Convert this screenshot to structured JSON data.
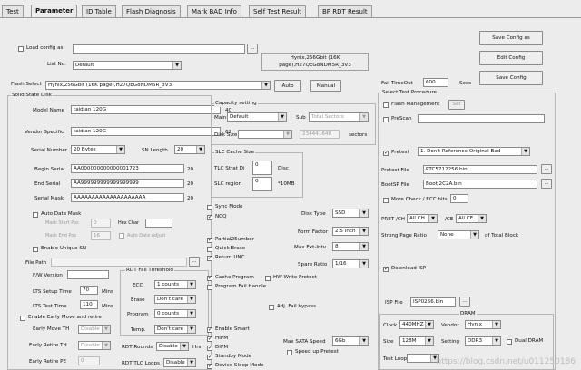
{
  "tabs": [
    "Test",
    "Parameter",
    "ID Table",
    "Flash Diagnosis",
    "Mark BAD Info",
    "Self Test Result",
    "BP RDT Result"
  ],
  "top": {
    "load_config_as": "Load config as",
    "list_no_label": "List No.",
    "list_no_value": "Default",
    "flash_select_label": "Flash Select",
    "flash_select_value": "Hynix,256Gbit (16K page),H27QEG8NDM5R_3V3",
    "info_line1": "Hynix,256Gbit (16K",
    "info_line2": "page),H27QEG8NDM5R_3V3",
    "auto_btn": "Auto",
    "manual_btn": "Manual",
    "save_config_as_btn": "Save Config as",
    "edit_config_btn": "Edit Config",
    "save_config_btn": "Save Config",
    "fail_timeout_label": "Fail TimeOut",
    "fail_timeout_value": "600",
    "fail_timeout_unit": "Secs"
  },
  "ssd": {
    "title": "Solid State Disk",
    "model_name_label": "Model Name",
    "model_name_value": "taidian 120G",
    "model_name_count": "40",
    "vendor_specific_label": "Vendor Specific",
    "vendor_specific_value": "taidian 120G",
    "vendor_specific_count": "62",
    "serial_number_label": "Serial Number",
    "serial_number_value": "20 Bytes",
    "sn_length_label": "SN Length",
    "sn_length_value": "20",
    "begin_serial_label": "Begin Serial",
    "begin_serial_value": "AA000000000000001723",
    "begin_serial_count": "20",
    "end_serial_label": "End Serial",
    "end_serial_value": "AA999999999999999999",
    "end_serial_count": "20",
    "serial_mask_label": "Serial Mask",
    "serial_mask_value": "AAAAAAAAAAAAAAAAAAAA",
    "serial_mask_count": "20",
    "auto_date_mask": "Auto Date Mask",
    "mask_start_pos_label": "Mask Start Pos",
    "mask_start_pos_value": "0",
    "hex_char_label": "Hex Char",
    "mask_end_pos_label": "Mask End Pos",
    "mask_end_pos_value": "16",
    "auto_date_adjust": "Auto Date Adjust",
    "enable_unique_sn": "Enable Unique SN",
    "file_path_label": "File Path",
    "fw_version_label": "F/W Version",
    "lts_setup_label": "LTS Setup Time",
    "lts_setup_value": "70",
    "lts_setup_unit": "Mins",
    "lts_test_label": "LTS Test Time",
    "lts_test_value": "110",
    "lts_test_unit": "Mins",
    "enable_early_move": "Enable Early Move and retire",
    "early_move_th_label": "Early Move TH",
    "early_move_th_value": "Disable",
    "early_retire_th_label": "Early Retire TH",
    "early_retire_th_value": "Disable",
    "early_retire_pe_label": "Early Retire PE",
    "early_retire_pe_value": "0"
  },
  "rdt": {
    "title": "RDT Fail Threshold",
    "ecc_label": "ECC",
    "ecc_value": "1 counts",
    "erase_label": "Erase",
    "erase_value": "Don't care",
    "program_label": "Program",
    "program_value": "0 counts",
    "temp_label": "Temp.",
    "temp_value": "Don't care",
    "rounds_label": "RDT Rounds",
    "rounds_value": "Disable",
    "rounds_unit": "Hrs",
    "tlc_loops_label": "RDT TLC Loops",
    "tlc_loops_value": "Disable"
  },
  "capacity": {
    "title": "Capacity setting",
    "main_label": "Main",
    "main_value": "Default",
    "sub_label": "Sub",
    "sub_value": "Total Sectors",
    "disk_size_label": "Disk Size",
    "disk_size_value": "234441648",
    "disk_size_unit": "sectors"
  },
  "slc": {
    "title": "SLC Cache Size",
    "tlc_strat_label": "TLC Strat Di",
    "tlc_strat_value": "0",
    "tlc_strat_unit": "Disc",
    "slc_region_label": "SLC region",
    "slc_region_value": "0",
    "slc_region_unit": "*10MB"
  },
  "opts": {
    "sync_mode": "Sync Mode",
    "ncq": "NCQ",
    "partial_number": "Partial25umber",
    "quick_erase": "Quick Erase",
    "return_unc": "Return UNC",
    "cache_program": "Cache Program",
    "hw_write_protect": "HW Write Protect",
    "program_fail_handle": "Program Fail Handle",
    "adj_fail_bypass": "Adj. Fail bypass",
    "enable_smart": "Enable Smart",
    "hipm": "HIPM",
    "dipm": "DIPM",
    "standby_mode": "Standby Mode",
    "device_sleep_mode": "Device Sleep Mode"
  },
  "disk": {
    "disk_type_label": "Disk Type",
    "disk_type_value": "SSD",
    "form_factor_label": "Form Factor",
    "form_factor_value": "2.5 Inch",
    "max_ext_intv_label": "Max Ext-Intv",
    "max_ext_intv_value": "8",
    "spare_ratio_label": "Spare Ratio",
    "spare_ratio_value": "1/16",
    "max_sata_speed_label": "Max SATA Speed",
    "max_sata_speed_value": "6Gb",
    "speed_up_pretest": "Speed up Pretest"
  },
  "proc": {
    "title": "Select Test Procedure",
    "flash_management": "Flash Management",
    "set_btn": "Set",
    "prescan": "PreScan",
    "pretest": "Pretest",
    "pretest_value": "1. Don't Reference Original Bad",
    "pretest_file_label": "Pretest File",
    "pretest_file_value": "PTC5712256.bin",
    "bootsp_file_label": "BootSP File",
    "bootsp_file_value": "BootJ2C2A.bin",
    "more_check": "More Check / ECC bits",
    "more_check_value": "0",
    "pretch_label": "PRET /CH",
    "pretch_value": "All CH",
    "ce_label": "/CE",
    "ce_value": "All CE",
    "strong_page_label": "Strong Page Ratio",
    "strong_page_value": "None",
    "strong_page_unit": "of Total Block",
    "download_isp": "Download ISP",
    "isp_file_label": "ISP File",
    "isp_file_value": "ISP0256.bin"
  },
  "dram": {
    "title": "DRAM",
    "clock_label": "Clock",
    "clock_value": "440MHZ",
    "vendor_label": "Vendor",
    "vendor_value": "Hynix",
    "size_label": "Size",
    "size_value": "128M",
    "setting_label": "Setting",
    "setting_value": "DDR3",
    "dual_dram": "Dual DRAM",
    "test_loop_label": "Test Loop"
  },
  "watermark": "https://blog.csdn.net/u011250186"
}
